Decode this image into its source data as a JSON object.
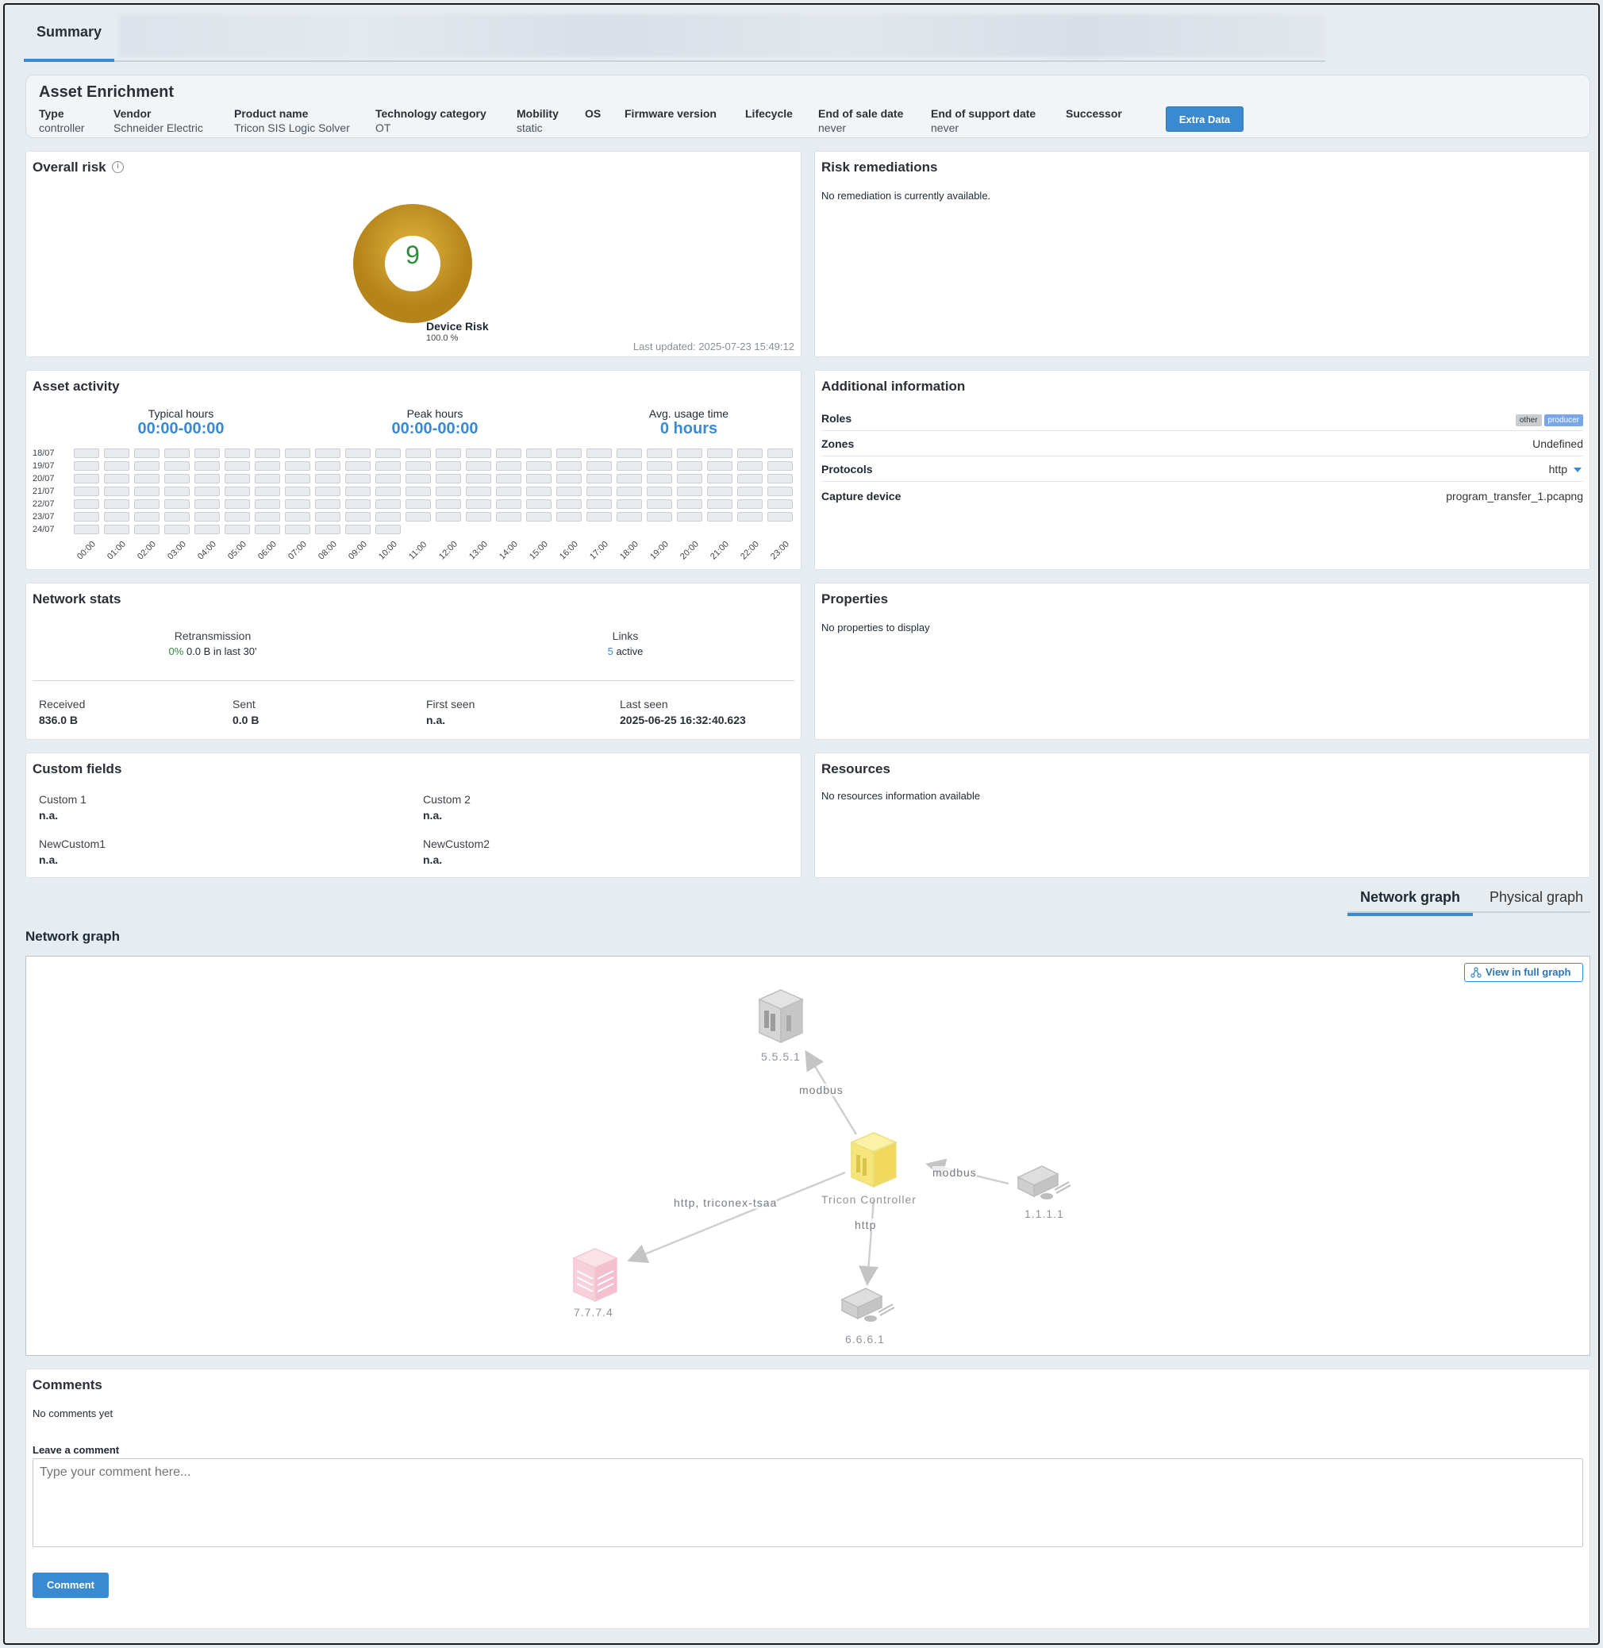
{
  "tabs": {
    "summary": "Summary"
  },
  "enrichment": {
    "title": "Asset Enrichment",
    "fields": [
      {
        "key": "Type",
        "value": "controller"
      },
      {
        "key": "Vendor",
        "value": "Schneider Electric"
      },
      {
        "key": "Product name",
        "value": "Tricon SIS Logic Solver"
      },
      {
        "key": "Technology category",
        "value": "OT"
      },
      {
        "key": "Mobility",
        "value": "static"
      },
      {
        "key": "OS",
        "value": ""
      },
      {
        "key": "Firmware version",
        "value": ""
      },
      {
        "key": "Lifecycle",
        "value": ""
      },
      {
        "key": "End of sale date",
        "value": "never"
      },
      {
        "key": "End of support date",
        "value": "never"
      },
      {
        "key": "Successor",
        "value": ""
      }
    ],
    "extra_button": "Extra Data"
  },
  "risk": {
    "title": "Overall risk",
    "score": "9",
    "label": "Device Risk",
    "percent": "100.0 %",
    "last_updated": "Last updated: 2025-07-23 15:49:12",
    "colors": {
      "ring": "#c8961f",
      "score": "#2e8b3a"
    }
  },
  "remediations": {
    "title": "Risk remediations",
    "text": "No remediation is currently available."
  },
  "activity": {
    "title": "Asset activity",
    "typical_label": "Typical hours",
    "typical_value": "00:00-00:00",
    "peak_label": "Peak hours",
    "peak_value": "00:00-00:00",
    "avg_label": "Avg. usage time",
    "avg_value": "0 hours",
    "days": [
      "18/07",
      "19/07",
      "20/07",
      "21/07",
      "22/07",
      "23/07",
      "24/07"
    ],
    "hours": [
      "00:00",
      "01:00",
      "02:00",
      "03:00",
      "04:00",
      "05:00",
      "06:00",
      "07:00",
      "08:00",
      "09:00",
      "10:00",
      "11:00",
      "12:00",
      "13:00",
      "14:00",
      "15:00",
      "16:00",
      "17:00",
      "18:00",
      "19:00",
      "20:00",
      "21:00",
      "22:00",
      "23:00"
    ]
  },
  "additional": {
    "title": "Additional information",
    "rows": [
      {
        "key": "Roles",
        "value": ""
      },
      {
        "key": "Zones",
        "value": "Undefined"
      },
      {
        "key": "Protocols",
        "value": "http"
      },
      {
        "key": "Capture device",
        "value": "program_transfer_1.pcapng"
      }
    ],
    "role_badges": [
      "other",
      "producer"
    ]
  },
  "network_stats": {
    "title": "Network stats",
    "retransmission_label": "Retransmission",
    "retransmission_pct": "0%",
    "retransmission_rest": "0.0 B in last 30'",
    "links_label": "Links",
    "links_count": "5",
    "links_rest": "active",
    "received_label": "Received",
    "received_value": "836.0 B",
    "sent_label": "Sent",
    "sent_value": "0.0 B",
    "first_seen_label": "First seen",
    "first_seen_value": "n.a.",
    "last_seen_label": "Last seen",
    "last_seen_value": "2025-06-25 16:32:40.623"
  },
  "properties": {
    "title": "Properties",
    "text": "No properties to display"
  },
  "custom_fields": {
    "title": "Custom fields",
    "fields": [
      {
        "key": "Custom 1",
        "value": "n.a."
      },
      {
        "key": "Custom 2",
        "value": "n.a."
      },
      {
        "key": "NewCustom1",
        "value": "n.a."
      },
      {
        "key": "NewCustom2",
        "value": "n.a."
      }
    ]
  },
  "resources": {
    "title": "Resources",
    "text": "No resources information available"
  },
  "graph_tabs": {
    "network": "Network graph",
    "physical": "Physical graph"
  },
  "graph": {
    "title": "Network graph",
    "full_button": "View in full graph",
    "nodes": {
      "n1": "5.5.5.1",
      "center": "Tricon Controller",
      "n2": "1.1.1.1",
      "n3": "7.7.7.4",
      "n4": "6.6.6.1"
    },
    "edges": {
      "e1": "modbus",
      "e2": "modbus",
      "e3": "http, triconex-tsaa",
      "e4": "http"
    }
  },
  "comments": {
    "title": "Comments",
    "empty": "No comments yet",
    "leave_label": "Leave a comment",
    "placeholder": "Type your comment here...",
    "button": "Comment"
  }
}
